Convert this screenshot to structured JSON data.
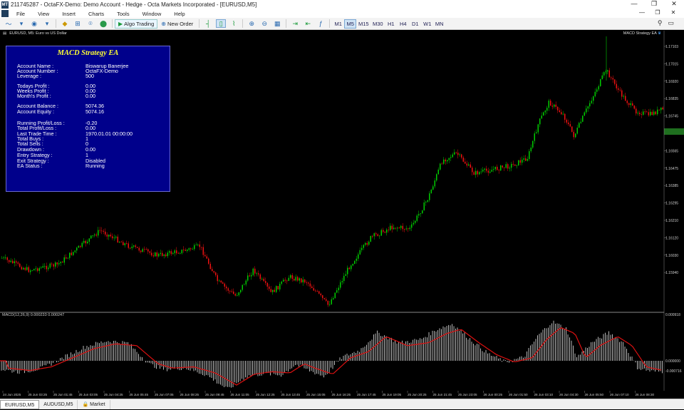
{
  "window": {
    "title": "211745287 - OctaFX-Demo: Demo Account - Hedge - Octa Markets Incorporated - [EURUSD,M5]",
    "app_icon": "MT"
  },
  "menu": {
    "items": [
      "File",
      "View",
      "Insert",
      "Charts",
      "Tools",
      "Window",
      "Help"
    ]
  },
  "toolbar": {
    "algo_trading_label": "Algo Trading",
    "new_order_label": "New Order",
    "timeframes": [
      "M1",
      "M5",
      "M15",
      "M30",
      "H1",
      "H4",
      "D1",
      "W1",
      "MN"
    ],
    "active_timeframe": "M5"
  },
  "chart": {
    "symbol_label": "EURUSD, M5: Euro vs US Dollar",
    "strategy_tag": "MACD Strategy EA",
    "price_ticks": [
      "1.17103",
      "1.17015",
      "1.16920",
      "1.16835",
      "1.16745",
      "1.16655",
      "1.16565",
      "1.16475",
      "1.16385",
      "1.16295",
      "1.16210",
      "1.16120",
      "1.16030",
      "1.15940"
    ],
    "time_ticks": [
      "24 Jun 2025",
      "25 Jun 03:25",
      "25 Jun 01:45",
      "25 Jun 03:05",
      "25 Jun 04:25",
      "25 Jun 05:45",
      "25 Jun 07:05",
      "25 Jun 08:25",
      "25 Jun 09:45",
      "25 Jun 11:05",
      "25 Jun 12:25",
      "25 Jun 13:45",
      "25 Jun 15:05",
      "25 Jun 16:25",
      "25 Jun 17:45",
      "25 Jun 19:05",
      "25 Jun 20:25",
      "25 Jun 21:45",
      "25 Jun 23:05",
      "26 Jun 00:25",
      "26 Jun 01:50",
      "26 Jun 03:10",
      "26 Jun 04:30",
      "26 Jun 05:50",
      "26 Jun 07:10",
      "26 Jun 08:30"
    ],
    "macd_label": "MACD(12,26,9) 0.000233 0.000247",
    "macd_ticks": [
      "0.000918",
      "0.000000",
      "-0.000716"
    ],
    "colors": {
      "bull": "#00cc00",
      "bear": "#ee1111",
      "signal": "#dd1111",
      "hist": "#e8e8e8"
    }
  },
  "ea_panel": {
    "title": "MACD Strategy EA",
    "rows": [
      {
        "label": "Account Name :",
        "value": "Biswarup Banerjee"
      },
      {
        "label": "Account Number :",
        "value": "OctaFX-Demo"
      },
      {
        "label": "Leverage :",
        "value": "500"
      },
      {
        "label": "Todays Profit :",
        "value": "0.00"
      },
      {
        "label": "Weeks Profit :",
        "value": "0.00"
      },
      {
        "label": "Month's Profit :",
        "value": "0.00"
      },
      {
        "label": "Account Balance :",
        "value": "5074.36"
      },
      {
        "label": "Account Equity :",
        "value": "5074.16"
      },
      {
        "label": "Running Profit/Loss :",
        "value": "-0.20"
      },
      {
        "label": "Total Profit/Loss :",
        "value": "0.00"
      },
      {
        "label": "Last Trade Time :",
        "value": "1970.01.01 00:00:00"
      },
      {
        "label": "Total Buys :",
        "value": "1"
      },
      {
        "label": "Total Sells :",
        "value": "0"
      },
      {
        "label": "Drawdown :",
        "value": "0.00"
      },
      {
        "label": "Entry Strategy :",
        "value": "1"
      },
      {
        "label": "Exit Strategy :",
        "value": "Disabled"
      },
      {
        "label": "EA Status :",
        "value": "Running"
      }
    ]
  },
  "tabs": {
    "items": [
      "EURUSD,M5",
      "AUDUSD,M5",
      "Market"
    ],
    "active": "EURUSD,M5"
  }
}
